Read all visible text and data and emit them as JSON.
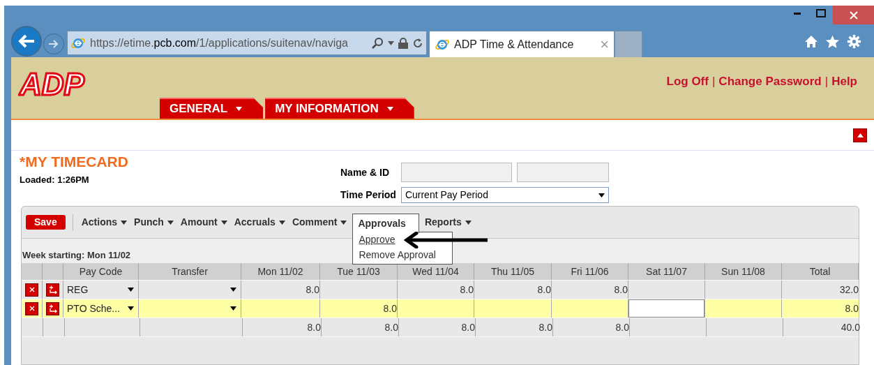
{
  "browser": {
    "url_host_prefix": "https://etime.",
    "url_host": "pcb.com",
    "url_path": "/1/applications/suitenav/naviga",
    "tabs": [
      {
        "title": "ADP Time & Attendance",
        "close": "×",
        "selected": true
      }
    ]
  },
  "header": {
    "logo": "ADP",
    "links": [
      "Log Off",
      "Change Password",
      "Help"
    ],
    "separator": "|",
    "nav_tabs": [
      "GENERAL",
      "MY INFORMATION"
    ]
  },
  "timecard": {
    "title": "*MY TIMECARD",
    "loaded": "Loaded: 1:26PM",
    "name_label": "Name & ID",
    "period_label": "Time Period",
    "period_value": "Current Pay Period",
    "save": "Save",
    "menus": [
      {
        "label": "Actions",
        "open": false
      },
      {
        "label": "Punch",
        "open": false
      },
      {
        "label": "Amount",
        "open": false
      },
      {
        "label": "Accruals",
        "open": false
      },
      {
        "label": "Comment",
        "open": false
      },
      {
        "label": "Approvals",
        "open": true,
        "items": [
          {
            "label": "Approve",
            "hovered": true
          },
          {
            "label": "Remove Approval",
            "hovered": false
          }
        ]
      },
      {
        "label": "Reports",
        "open": false
      }
    ],
    "week": "Week starting: Mon 11/02",
    "columns": [
      "Pay Code",
      "Transfer",
      "Mon 11/02",
      "Tue 11/03",
      "Wed 11/04",
      "Thu 11/05",
      "Fri 11/06",
      "Sat 11/07",
      "Sun 11/08",
      "Total"
    ],
    "rows": [
      {
        "kind": "entry",
        "selected": false,
        "pay_code": "REG",
        "days": [
          {
            "value": "8.0",
            "editing": false
          },
          {
            "editing": false
          },
          {
            "value": "8.0",
            "editing": false
          },
          {
            "value": "8.0",
            "editing": false
          },
          {
            "value": "8.0",
            "editing": false
          },
          {
            "editing": false
          },
          {
            "editing": false
          }
        ],
        "total": "32.0"
      },
      {
        "kind": "entry",
        "selected": true,
        "pay_code": "PTO Sche...",
        "days": [
          {
            "editing": false
          },
          {
            "value": "8.0",
            "editing": false
          },
          {
            "editing": false
          },
          {
            "editing": false
          },
          {
            "editing": false
          },
          {
            "editing": true
          },
          {
            "editing": false
          }
        ],
        "total": "8.0"
      },
      {
        "kind": "total",
        "selected": false,
        "days": [
          {
            "value": "8.0",
            "editing": false
          },
          {
            "value": "8.0",
            "editing": false
          },
          {
            "value": "8.0",
            "editing": false
          },
          {
            "value": "8.0",
            "editing": false
          },
          {
            "value": "8.0",
            "editing": false
          },
          {
            "editing": false
          },
          {
            "editing": false
          }
        ],
        "total": "40.0"
      }
    ]
  }
}
